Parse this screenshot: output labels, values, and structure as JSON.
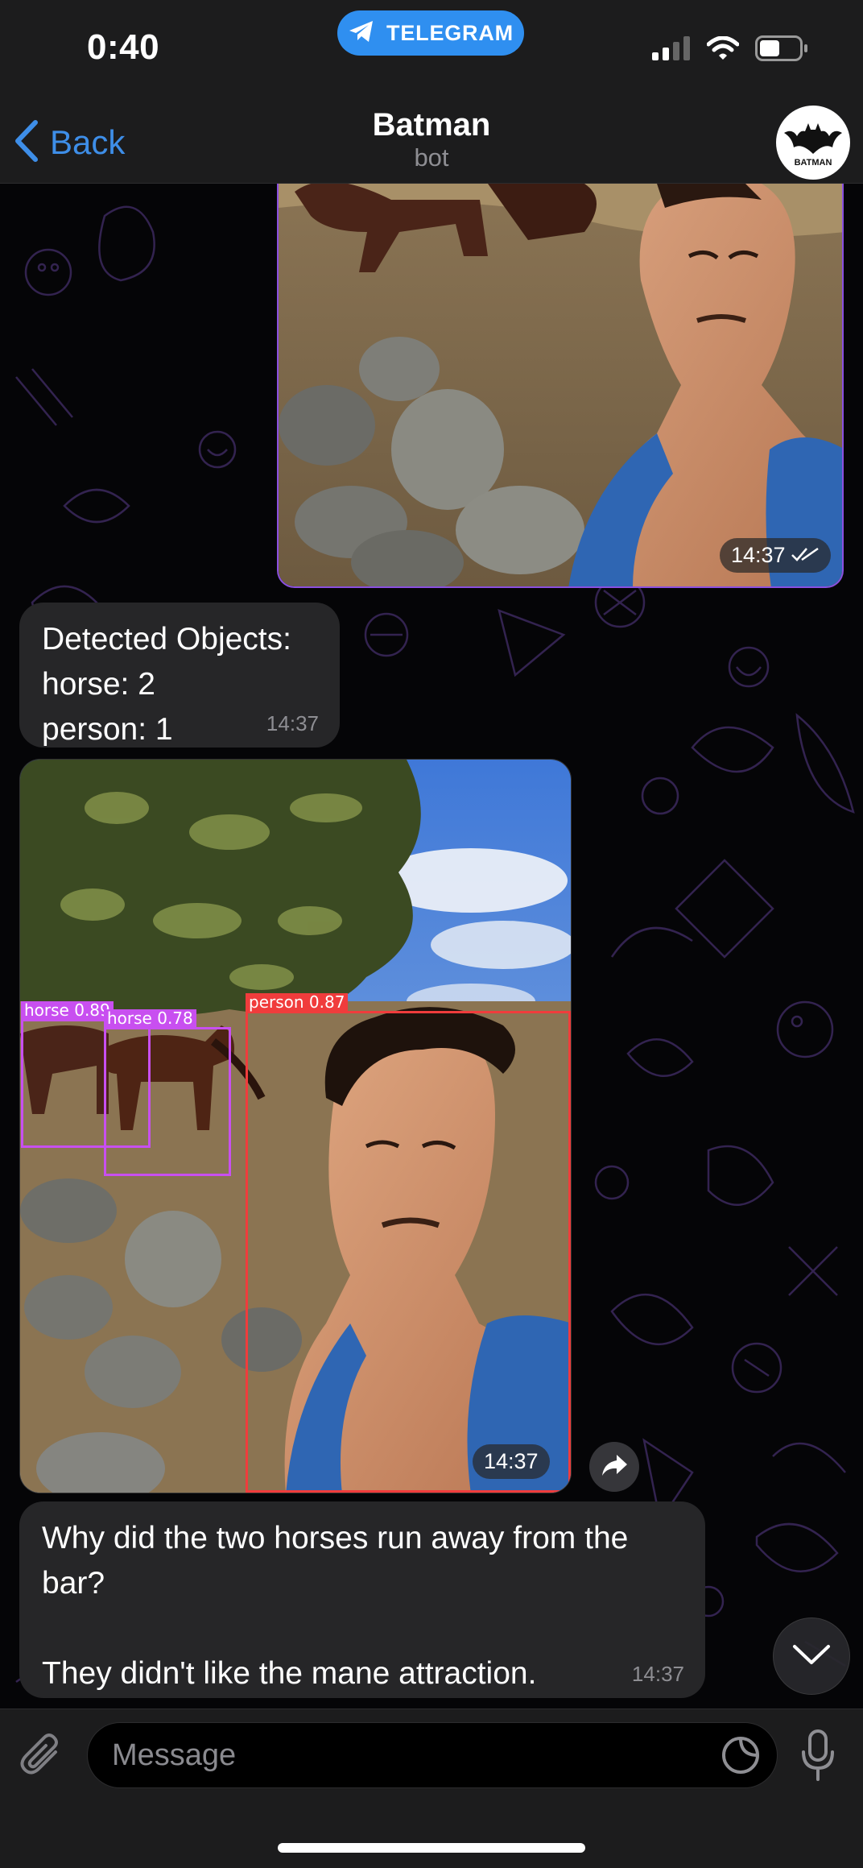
{
  "status_bar": {
    "time": "0:40",
    "app_pill": "TELEGRAM"
  },
  "nav": {
    "back_label": "Back",
    "title": "Batman",
    "subtitle": "bot",
    "avatar_text": "BATMAN"
  },
  "messages": {
    "photo_out": {
      "time": "14:37",
      "status": "read"
    },
    "detected": {
      "lines": [
        "Detected Objects:",
        "horse: 2",
        "person: 1"
      ],
      "time": "14:37"
    },
    "photo_in": {
      "time": "14:37",
      "detections": [
        {
          "label": "horse 0.89",
          "color": "#c84ff0"
        },
        {
          "label": "horse 0.78",
          "color": "#c84ff0"
        },
        {
          "label": "person 0.87",
          "color": "#f03c3c"
        }
      ]
    },
    "joke": {
      "lines": [
        "Why did the two horses run away from the",
        "bar?",
        "",
        "They didn't like the mane attraction."
      ],
      "time": "14:37"
    }
  },
  "input": {
    "placeholder": "Message"
  },
  "colors": {
    "accent": "#3e8ee8",
    "telegram_pill": "#2f8ff0",
    "outgoing_border": "#8a4fe0",
    "bubble": "#262628"
  },
  "icons": [
    "telegram-plane-icon",
    "signal-icon",
    "wifi-icon",
    "battery-icon",
    "chevron-left-icon",
    "bat-logo-icon",
    "read-checkmarks-icon",
    "share-arrow-icon",
    "chevron-down-icon",
    "paperclip-icon",
    "sticker-icon",
    "microphone-icon"
  ]
}
